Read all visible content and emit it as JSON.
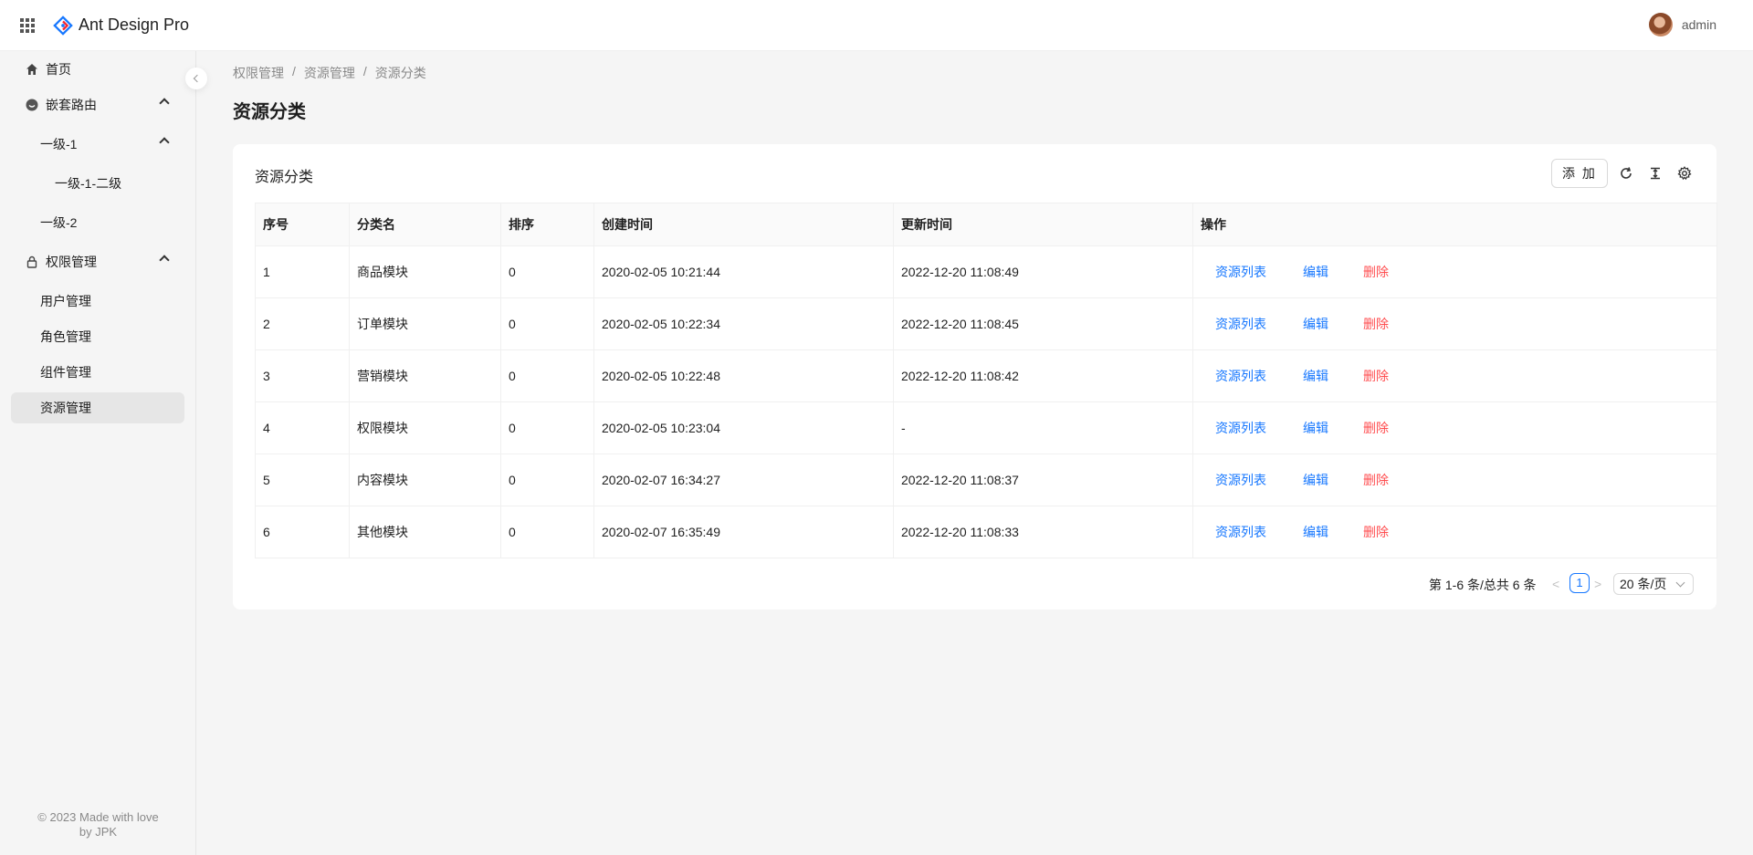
{
  "header": {
    "title": "Ant Design Pro",
    "user_name": "admin",
    "accent": "#1677ff"
  },
  "sidebar": {
    "items": [
      {
        "label": "首页",
        "icon": "home-icon"
      },
      {
        "label": "嵌套路由",
        "icon": "smile-icon"
      },
      {
        "label": "一级-1"
      },
      {
        "label": "一级-1-二级"
      },
      {
        "label": "一级-2"
      },
      {
        "label": "权限管理",
        "icon": "lock-icon"
      },
      {
        "label": "用户管理"
      },
      {
        "label": "角色管理"
      },
      {
        "label": "组件管理"
      },
      {
        "label": "资源管理",
        "selected": true
      }
    ],
    "footer_line1": "© 2023 Made with love",
    "footer_line2": "by JPK"
  },
  "breadcrumb": [
    "权限管理",
    "资源管理",
    "资源分类"
  ],
  "page": {
    "title": "资源分类"
  },
  "card": {
    "title": "资源分类",
    "add_label": "添 加",
    "toolbar_icons": [
      "reload-icon",
      "column-height-icon",
      "setting-icon"
    ]
  },
  "table": {
    "columns": [
      "序号",
      "分类名",
      "排序",
      "创建时间",
      "更新时间",
      "操作"
    ],
    "rows": [
      {
        "id": "1",
        "name": "商品模块",
        "sort": "0",
        "created": "2020-02-05 10:21:44",
        "updated": "2022-12-20 11:08:49"
      },
      {
        "id": "2",
        "name": "订单模块",
        "sort": "0",
        "created": "2020-02-05 10:22:34",
        "updated": "2022-12-20 11:08:45"
      },
      {
        "id": "3",
        "name": "营销模块",
        "sort": "0",
        "created": "2020-02-05 10:22:48",
        "updated": "2022-12-20 11:08:42"
      },
      {
        "id": "4",
        "name": "权限模块",
        "sort": "0",
        "created": "2020-02-05 10:23:04",
        "updated": "-"
      },
      {
        "id": "5",
        "name": "内容模块",
        "sort": "0",
        "created": "2020-02-07 16:34:27",
        "updated": "2022-12-20 11:08:37"
      },
      {
        "id": "6",
        "name": "其他模块",
        "sort": "0",
        "created": "2020-02-07 16:35:49",
        "updated": "2022-12-20 11:08:33"
      }
    ],
    "actions": {
      "list": "资源列表",
      "edit": "编辑",
      "delete": "删除"
    }
  },
  "pagination": {
    "total_text": "第 1-6 条/总共 6 条",
    "current_page": "1",
    "page_size": "20 条/页",
    "prev": "<",
    "next": ">"
  }
}
